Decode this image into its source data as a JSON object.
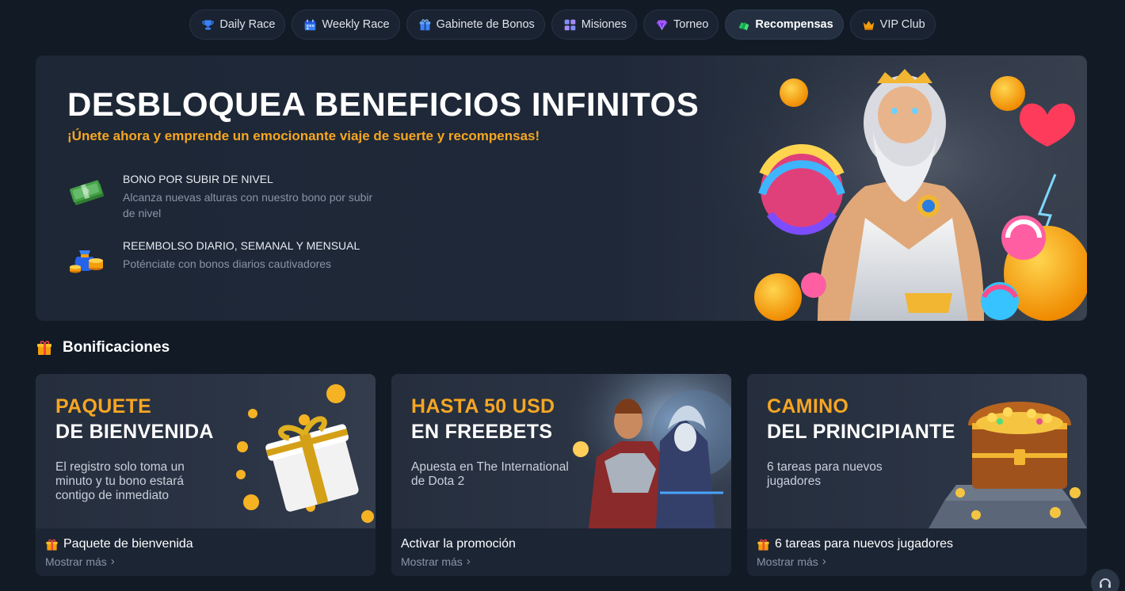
{
  "tabs": [
    {
      "label": "Daily Race",
      "icon": "trophy-icon",
      "active": false
    },
    {
      "label": "Weekly Race",
      "icon": "calendar-icon",
      "active": false
    },
    {
      "label": "Gabinete de Bonos",
      "icon": "gift-icon",
      "active": false
    },
    {
      "label": "Misiones",
      "icon": "grid-icon",
      "active": false
    },
    {
      "label": "Torneo",
      "icon": "diamond-icon",
      "active": false
    },
    {
      "label": "Recompensas",
      "icon": "money-icon",
      "active": true
    },
    {
      "label": "VIP Club",
      "icon": "crown-icon",
      "active": false
    }
  ],
  "hero": {
    "title": "DESBLOQUEA BENEFICIOS INFINITOS",
    "subtitle": "¡Únete ahora y emprende un emocionante viaje de suerte y recompensas!",
    "features": [
      {
        "icon": "cash-stack-icon",
        "title": "BONO POR SUBIR DE NIVEL",
        "description": "Alcanza nuevas alturas con nuestro bono por subir de nivel"
      },
      {
        "icon": "coin-bag-icon",
        "title": "REEMBOLSO DIARIO, SEMANAL Y MENSUAL",
        "description": "Poténciate con bonos diarios cautivadores"
      }
    ]
  },
  "section": {
    "title": "Bonificaciones",
    "icon": "gift-icon"
  },
  "cards": [
    {
      "heading_line1": "PAQUETE",
      "heading_line2": "DE BIENVENIDA",
      "description": "El registro solo toma un minuto y tu bono estará contigo de inmediato",
      "action": "Paquete de bienvenida",
      "action_icon": "gift-icon",
      "more": "Mostrar más"
    },
    {
      "heading_line1": "HASTA 50 USD",
      "heading_line2": "EN FREEBETS",
      "description": "Apuesta en The International de Dota 2",
      "action": "Activar la promoción",
      "action_icon": "",
      "more": "Mostrar más"
    },
    {
      "heading_line1": "CAMINO",
      "heading_line2": "DEL PRINCIPIANTE",
      "description": "6 tareas para nuevos jugadores",
      "action": "6 tareas para nuevos jugadores",
      "action_icon": "gift-icon",
      "more": "Mostrar más"
    }
  ],
  "colors": {
    "background": "#121a26",
    "accent": "#f5a623",
    "card": "#1c2534",
    "muted_text": "#8a94a6"
  }
}
